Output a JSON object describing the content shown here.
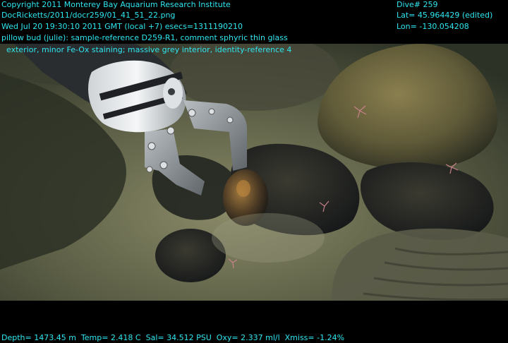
{
  "overlay": {
    "line1": "Copyright 2011 Monterey Bay Aquarium Research Institute",
    "line2": "DocRicketts/2011/docr259/01_41_51_22.png",
    "line3": "Wed Jul 20 19:30:10 2011 GMT (local +7)  esecs=1311190210",
    "line4": "pillow bud (julie): sample-reference D259-R1, comment sphyric thin glass",
    "line5": "  exterior, minor Fe-Ox staining; massive grey interior, identity-reference 4",
    "dive": "Dive# 259",
    "lat": "Lat= 45.964429 (edited)",
    "lon": "Lon= -130.054208",
    "telemetry": "Depth= 1473.45 m  Temp= 2.418 C  Sal= 34.512 PSU  Oxy= 2.337 ml/l  Xmiss= -1.24%"
  },
  "colors": {
    "overlay_text": "#2ee6f0",
    "background": "#000000"
  }
}
